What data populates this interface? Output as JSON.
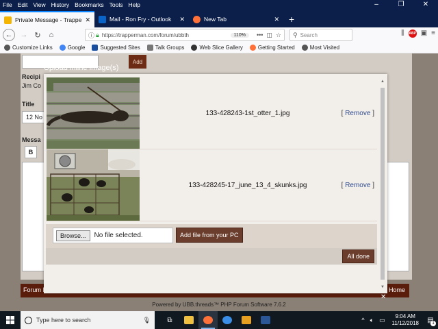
{
  "menubar": {
    "items": [
      "File",
      "Edit",
      "View",
      "History",
      "Bookmarks",
      "Tools",
      "Help"
    ],
    "accel": [
      "F",
      "E",
      "V",
      "H",
      "B",
      "T",
      "H"
    ]
  },
  "tabs": [
    {
      "label": "Private Message - Trapperman",
      "icon_color": "#f5b400",
      "active": true
    },
    {
      "label": "Mail - Ron Fry - Outlook",
      "icon_color": "#0a64c8",
      "active": false
    },
    {
      "label": "New Tab",
      "icon_color": "#ff7139",
      "active": false
    }
  ],
  "nav": {
    "url": "https://trapperman.com/forum/ubbth",
    "zoom": "110%",
    "search_placeholder": "Search"
  },
  "bookmarks": [
    {
      "label": "Customize Links",
      "icon_color": "#555555"
    },
    {
      "label": "Google",
      "icon_color": "#4285f4"
    },
    {
      "label": "Suggested Sites",
      "icon_color": "#1a4fa0"
    },
    {
      "label": "Talk Groups",
      "icon_color": "#777777"
    },
    {
      "label": "Web Slice Gallery",
      "icon_color": "#333333"
    },
    {
      "label": "Getting Started",
      "icon_color": "#ff7139"
    },
    {
      "label": "Most Visited",
      "icon_color": "#555555"
    }
  ],
  "background": {
    "add_label": "Add",
    "recipient_label": "Recipi",
    "recipient_value": "Jim Co",
    "title_label": "Title",
    "title_value": "12 No",
    "message_label": "Messa",
    "bold_label": "B",
    "footer_left": "Forum Rules",
    "footer_right": "Home",
    "powered": "Powered by UBB.threads™ PHP Forum Software 7.6.2"
  },
  "modal": {
    "title": "Upload inline image(s)",
    "files": [
      {
        "name": "133-428243-1st_otter_1.jpg",
        "remove_open": "[",
        "remove_label": "Remove",
        "remove_close": "]"
      },
      {
        "name": "133-428245-17_june_13_4_skunks.jpg",
        "remove_open": "[",
        "remove_label": "Remove",
        "remove_close": "]"
      }
    ],
    "browse_label": "Browse...",
    "no_file": "No file selected.",
    "add_file_label": "Add file from your PC",
    "all_done_label": "All done",
    "close_glyph": "✕"
  },
  "taskbar": {
    "search_placeholder": "Type here to search",
    "time": "9:04 AM",
    "date": "11/12/2018",
    "notification_count": "1"
  }
}
